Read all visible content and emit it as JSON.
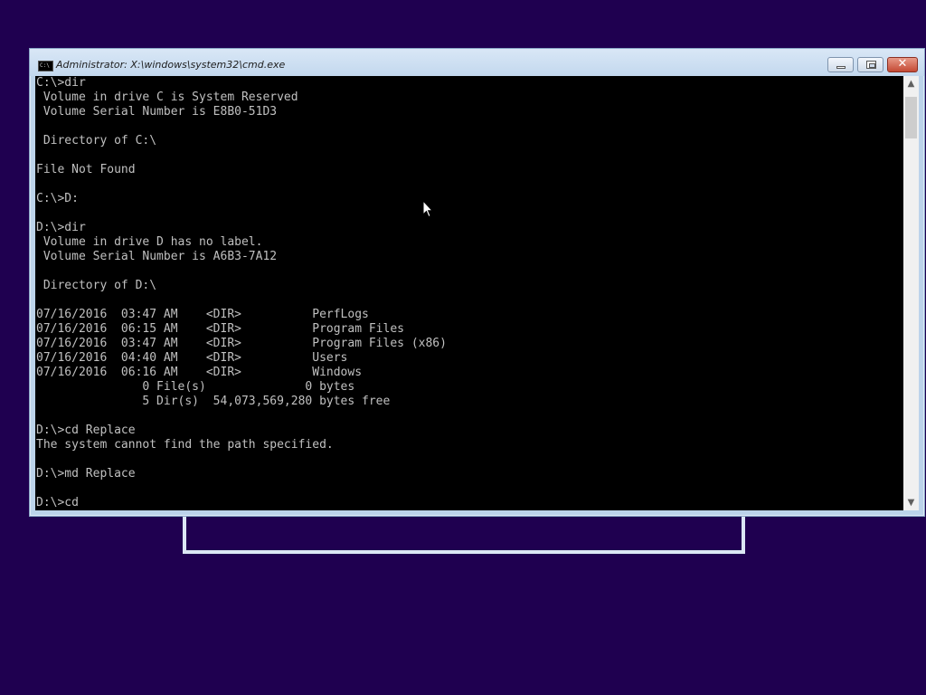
{
  "window": {
    "title": "Administrator: X:\\windows\\system32\\cmd.exe",
    "icon": "cmd-icon",
    "icon_label": "C:\\",
    "minimize_icon": "minimize-icon",
    "maximize_icon": "restore-icon",
    "close_icon": "close-icon",
    "close_glyph": "✕"
  },
  "console": {
    "lines": [
      "C:\\>dir",
      " Volume in drive C is System Reserved",
      " Volume Serial Number is E8B0-51D3",
      "",
      " Directory of C:\\",
      "",
      "File Not Found",
      "",
      "C:\\>D:",
      "",
      "D:\\>dir",
      " Volume in drive D has no label.",
      " Volume Serial Number is A6B3-7A12",
      "",
      " Directory of D:\\",
      "",
      "07/16/2016  03:47 AM    <DIR>          PerfLogs",
      "07/16/2016  06:15 AM    <DIR>          Program Files",
      "07/16/2016  03:47 AM    <DIR>          Program Files (x86)",
      "07/16/2016  04:40 AM    <DIR>          Users",
      "07/16/2016  06:16 AM    <DIR>          Windows",
      "               0 File(s)              0 bytes",
      "               5 Dir(s)  54,073,569,280 bytes free",
      "",
      "D:\\>cd Replace",
      "The system cannot find the path specified.",
      "",
      "D:\\>md Replace",
      "",
      "D:\\>cd"
    ]
  },
  "scrollbar": {
    "up_glyph": "▲",
    "down_glyph": "▼"
  },
  "colors": {
    "desktop_background": "#1f0050",
    "console_background": "#000000",
    "console_text": "#c0c0c0",
    "titlebar": "#c3d8ee",
    "close_button": "#c44a35"
  }
}
